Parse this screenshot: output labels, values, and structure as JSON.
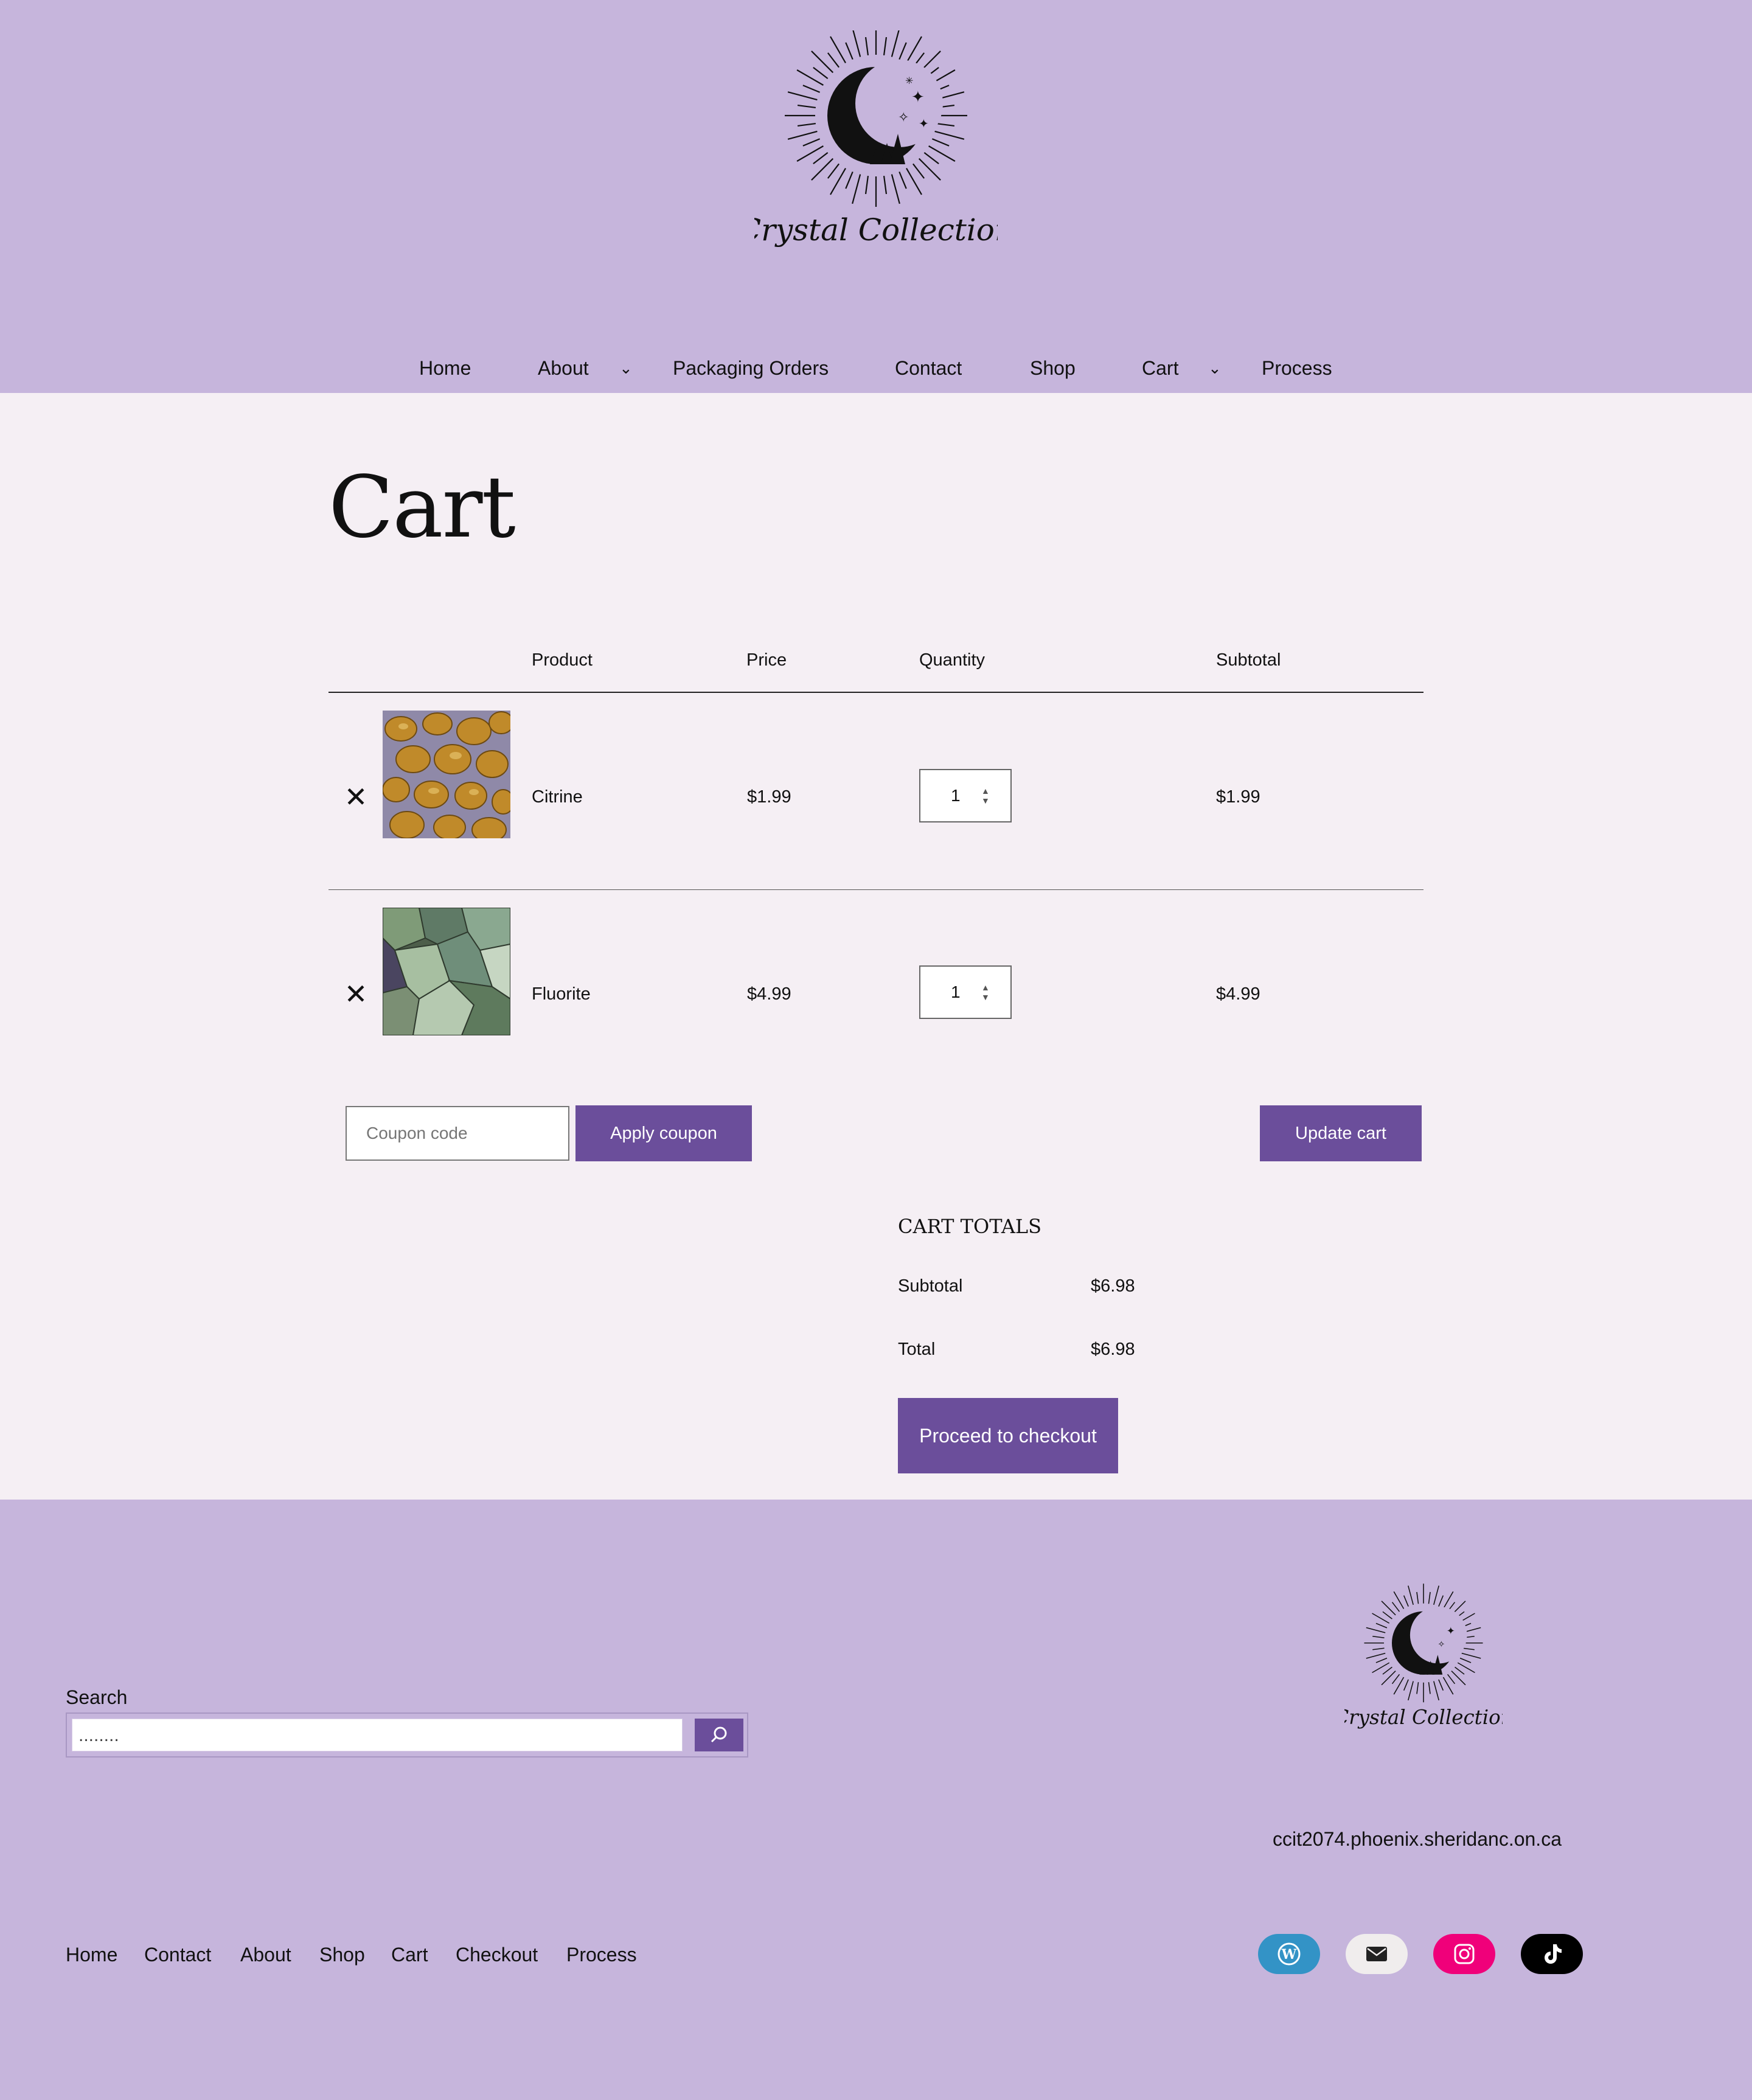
{
  "header": {
    "logo_text": "Crystal Collection",
    "nav": [
      "Home",
      "About",
      "Packaging Orders",
      "Contact",
      "Shop",
      "Cart",
      "Process"
    ]
  },
  "page": {
    "title": "Cart"
  },
  "table": {
    "headers": [
      "Product",
      "Price",
      "Quantity",
      "Subtotal"
    ],
    "rows": [
      {
        "product": "Citrine",
        "price": "$1.99",
        "quantity": "1",
        "subtotal": "$1.99"
      },
      {
        "product": "Fluorite",
        "price": "$4.99",
        "quantity": "1",
        "subtotal": "$4.99"
      }
    ]
  },
  "coupon": {
    "placeholder": "Coupon code",
    "apply_label": "Apply coupon",
    "update_label": "Update cart"
  },
  "totals": {
    "title": "CART TOTALS",
    "subtotal_label": "Subtotal",
    "subtotal_value": "$6.98",
    "total_label": "Total",
    "total_value": "$6.98",
    "checkout_label": "Proceed to checkout"
  },
  "footer": {
    "search_label": "Search",
    "search_value": "........",
    "site_url": "ccit2074.phoenix.sheridanc.on.ca",
    "nav": [
      "Home",
      "Contact",
      "About",
      "Shop",
      "Cart",
      "Checkout",
      "Process"
    ],
    "social": [
      "wordpress-icon",
      "mail-icon",
      "instagram-icon",
      "tiktok-icon"
    ]
  },
  "colors": {
    "header_bg": "#c6b5dc",
    "page_bg": "#f5eff4",
    "accent": "#6b4e9b"
  }
}
